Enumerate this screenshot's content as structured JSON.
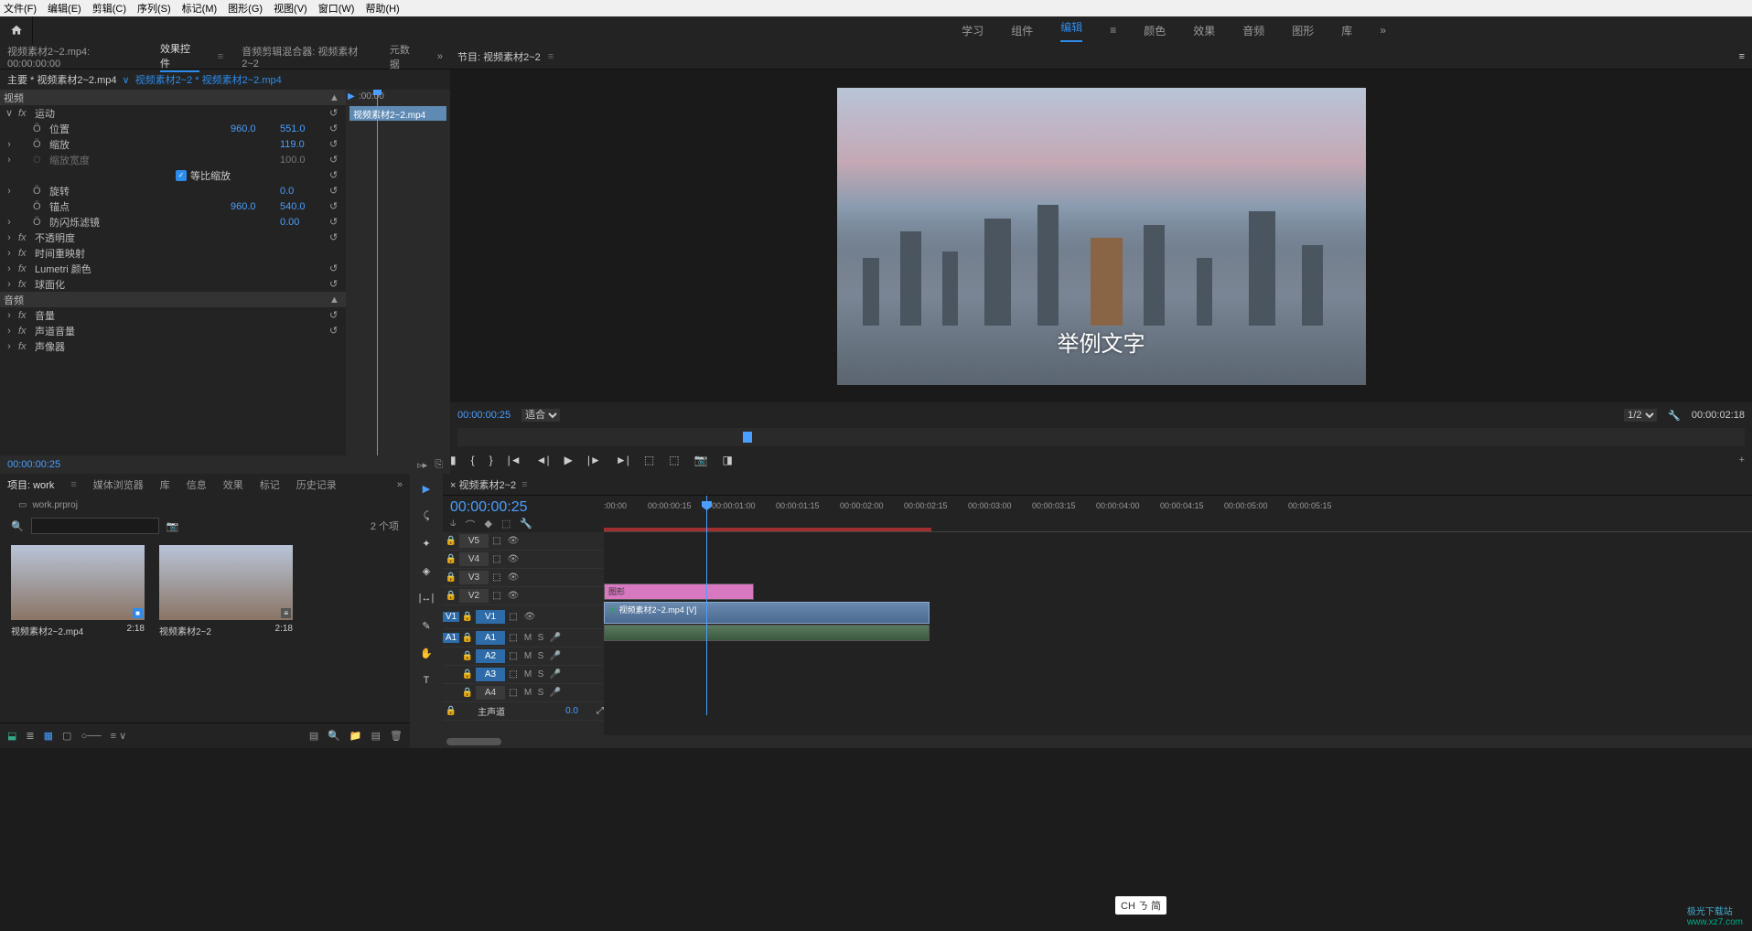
{
  "menu": {
    "file": "文件(F)",
    "edit": "编辑(E)",
    "clip": "剪辑(C)",
    "sequence": "序列(S)",
    "marker": "标记(M)",
    "graphics": "图形(G)",
    "view": "视图(V)",
    "window": "窗口(W)",
    "help": "帮助(H)"
  },
  "workspaces": {
    "learning": "学习",
    "assembly": "组件",
    "editing": "编辑",
    "color": "颜色",
    "effects": "效果",
    "audio": "音频",
    "graphics": "图形",
    "libraries": "库"
  },
  "left_tabs": {
    "source": "视频素材2~2.mp4: 00:00:00:00",
    "effect_controls": "效果控件",
    "audio_mixer": "音频剪辑混合器: 视频素材2~2",
    "metadata": "元数据"
  },
  "source_path": {
    "master": "主要 * 视频素材2~2.mp4",
    "sequence": "视频素材2~2 * 视频素材2~2.mp4"
  },
  "effects": {
    "video_header": "视频",
    "motion": {
      "label": "运动",
      "position": {
        "label": "位置",
        "x": "960.0",
        "y": "551.0"
      },
      "scale": {
        "label": "缩放",
        "value": "119.0"
      },
      "scale_width": {
        "label": "缩放宽度",
        "value": "100.0"
      },
      "uniform": {
        "label": "等比缩放"
      },
      "rotation": {
        "label": "旋转",
        "value": "0.0"
      },
      "anchor": {
        "label": "锚点",
        "x": "960.0",
        "y": "540.0"
      },
      "antiflicker": {
        "label": "防闪烁滤镜",
        "value": "0.00"
      }
    },
    "opacity": "不透明度",
    "time_remap": "时间重映射",
    "lumetri": "Lumetri 颜色",
    "spherize": "球面化",
    "audio_header": "音频",
    "volume": "音量",
    "channel_vol": "声道音量",
    "panner": "声像器"
  },
  "ef_timeline": {
    "start": ":00:00",
    "clip_name": "视频素材2~2.mp4"
  },
  "left_timecode": "00:00:00:25",
  "program": {
    "tab": "节目: 视频素材2~2",
    "sample_text": "举例文字",
    "timecode": "00:00:00:25",
    "fit": "适合",
    "scale": "1/2",
    "duration": "00:00:02:18"
  },
  "project": {
    "tabs": {
      "project": "项目: work",
      "media_browser": "媒体浏览器",
      "libraries": "库",
      "info": "信息",
      "effects": "效果",
      "markers": "标记",
      "history": "历史记录"
    },
    "name": "work.prproj",
    "count": "2 个项",
    "items": [
      {
        "name": "视频素材2~2.mp4",
        "duration": "2:18"
      },
      {
        "name": "视频素材2~2",
        "duration": "2:18"
      }
    ]
  },
  "timeline": {
    "tab": "视频素材2~2",
    "timecode": "00:00:00:25",
    "ruler": [
      ":00:00",
      "00:00:00:15",
      "00:00:01:00",
      "00:00:01:15",
      "00:00:02:00",
      "00:00:02:15",
      "00:00:03:00",
      "00:00:03:15",
      "00:00:04:00",
      "00:00:04:15",
      "00:00:05:00",
      "00:00:05:15"
    ],
    "tracks": {
      "v5": "V5",
      "v4": "V4",
      "v3": "V3",
      "v2": "V2",
      "v1": "V1",
      "a1": "A1",
      "a2": "A2",
      "a3": "A3",
      "a4": "A4",
      "master": "主声道",
      "master_val": "0.0"
    },
    "clips": {
      "graphic": "图形",
      "video": "视频素材2~2.mp4 [V]"
    }
  },
  "ime": "CH ㄋ 简",
  "watermark": {
    "brand": "极光下载站",
    "url": "www.xz7.com"
  }
}
